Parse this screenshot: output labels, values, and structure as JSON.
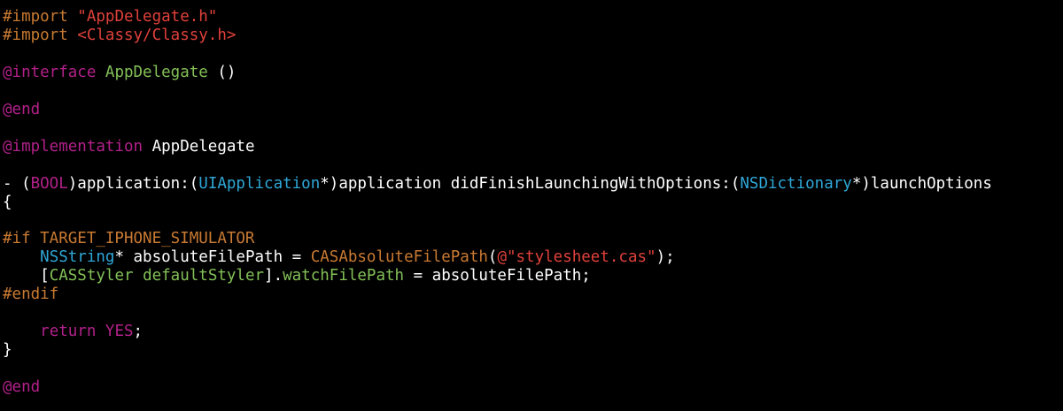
{
  "colors": {
    "background": "#000000",
    "plain": "#ffffff",
    "keyword": "#b2218a",
    "preprocessor": "#c97a32",
    "string": "#e0413b",
    "project_class": "#83c057",
    "system_class": "#2fa7d8",
    "method": "#83c057",
    "constant": "#c97a32"
  },
  "code_lines": [
    {
      "tokens": [
        {
          "text": "#import ",
          "kind": "preprocessor"
        },
        {
          "text": "\"AppDelegate.h\"",
          "kind": "string"
        }
      ]
    },
    {
      "tokens": [
        {
          "text": "#import ",
          "kind": "preprocessor"
        },
        {
          "text": "<Classy/Classy.h>",
          "kind": "string"
        }
      ]
    },
    {
      "tokens": []
    },
    {
      "tokens": [
        {
          "text": "@interface",
          "kind": "keyword"
        },
        {
          "text": " ",
          "kind": "plain"
        },
        {
          "text": "AppDelegate",
          "kind": "project_class"
        },
        {
          "text": " ()",
          "kind": "plain"
        }
      ]
    },
    {
      "tokens": []
    },
    {
      "tokens": [
        {
          "text": "@end",
          "kind": "keyword"
        }
      ]
    },
    {
      "tokens": []
    },
    {
      "tokens": [
        {
          "text": "@implementation",
          "kind": "keyword"
        },
        {
          "text": " AppDelegate",
          "kind": "plain"
        }
      ]
    },
    {
      "tokens": []
    },
    {
      "tokens": [
        {
          "text": "- (",
          "kind": "plain"
        },
        {
          "text": "BOOL",
          "kind": "keyword"
        },
        {
          "text": ")application:(",
          "kind": "plain"
        },
        {
          "text": "UIApplication",
          "kind": "system_class"
        },
        {
          "text": "*)application didFinishLaunchingWithOptions:(",
          "kind": "plain"
        },
        {
          "text": "NSDictionary",
          "kind": "system_class"
        },
        {
          "text": "*)launchOptions",
          "kind": "plain"
        }
      ]
    },
    {
      "tokens": [
        {
          "text": "{",
          "kind": "plain"
        }
      ]
    },
    {
      "tokens": []
    },
    {
      "tokens": [
        {
          "text": "#if TARGET_IPHONE_SIMULATOR",
          "kind": "preprocessor"
        }
      ]
    },
    {
      "tokens": [
        {
          "text": "    ",
          "kind": "plain"
        },
        {
          "text": "NSString",
          "kind": "system_class"
        },
        {
          "text": "* absoluteFilePath = ",
          "kind": "plain"
        },
        {
          "text": "CASAbsoluteFilePath",
          "kind": "constant"
        },
        {
          "text": "(",
          "kind": "plain"
        },
        {
          "text": "@\"stylesheet.cas\"",
          "kind": "string"
        },
        {
          "text": ");",
          "kind": "plain"
        }
      ]
    },
    {
      "tokens": [
        {
          "text": "    [",
          "kind": "plain"
        },
        {
          "text": "CASStyler",
          "kind": "project_class"
        },
        {
          "text": " ",
          "kind": "plain"
        },
        {
          "text": "defaultStyler",
          "kind": "method"
        },
        {
          "text": "].",
          "kind": "plain"
        },
        {
          "text": "watchFilePath",
          "kind": "method"
        },
        {
          "text": " = absoluteFilePath;",
          "kind": "plain"
        }
      ]
    },
    {
      "tokens": [
        {
          "text": "#endif",
          "kind": "preprocessor"
        }
      ]
    },
    {
      "tokens": []
    },
    {
      "tokens": [
        {
          "text": "    ",
          "kind": "plain"
        },
        {
          "text": "return",
          "kind": "keyword"
        },
        {
          "text": " ",
          "kind": "plain"
        },
        {
          "text": "YES",
          "kind": "keyword"
        },
        {
          "text": ";",
          "kind": "plain"
        }
      ]
    },
    {
      "tokens": [
        {
          "text": "}",
          "kind": "plain"
        }
      ]
    },
    {
      "tokens": []
    },
    {
      "tokens": [
        {
          "text": "@end",
          "kind": "keyword"
        }
      ]
    }
  ]
}
